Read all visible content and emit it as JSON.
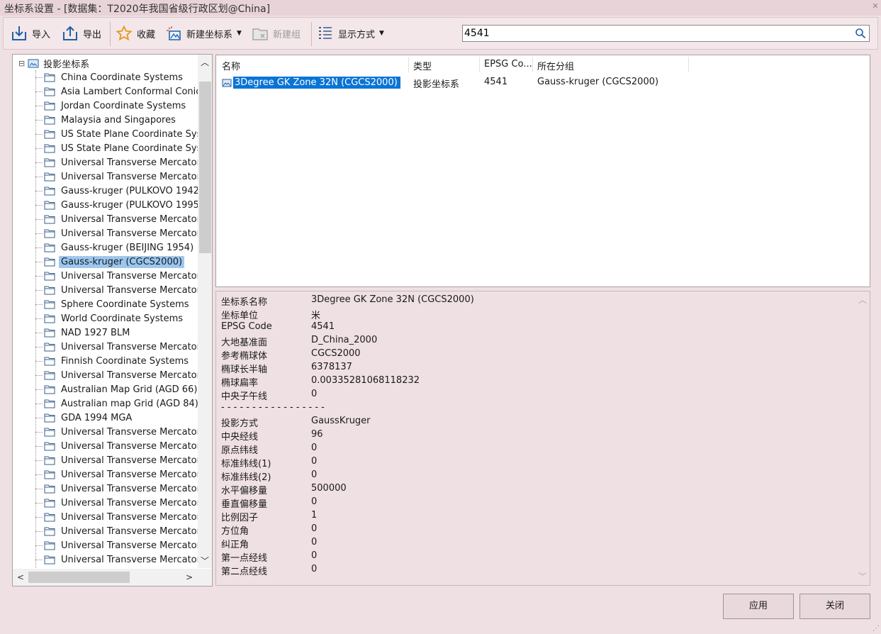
{
  "window": {
    "title": "坐标系设置 - [数据集：T2020年我国省级行政区划@China]"
  },
  "toolbar": {
    "import_label": "导入",
    "export_label": "导出",
    "favorite_label": "收藏",
    "new_coord_label": "新建坐标系",
    "new_group_label": "新建组",
    "display_label": "显示方式",
    "search_value": "4541"
  },
  "tree": {
    "root_label": "投影坐标系",
    "items": [
      "China Coordinate Systems",
      "Asia Lambert Conformal Conic",
      "Jordan Coordinate Systems",
      "Malaysia and Singapores",
      "US State Plane Coordinate Syste",
      "US State Plane Coordinate Syste",
      "Universal Transverse Mercator( \\",
      "Universal Transverse Mercator( \\",
      "Gauss-kruger (PULKOVO 1942)",
      "Gauss-kruger (PULKOVO 1995)",
      "Universal Transverse Mercator (I",
      "Universal Transverse Mercator (I",
      "Gauss-kruger (BEIJING 1954)",
      "Gauss-kruger (CGCS2000)",
      "Universal Transverse Mercator (I",
      "Universal Transverse Mercator (I",
      "Sphere Coordinate Systems",
      "World Coordinate Systems",
      "NAD 1927 BLM",
      "Universal Transverse Mercator (A",
      "Finnish Coordinate Systems",
      "Universal Transverse Mercator (S",
      "Australian Map Grid (AGD 66)",
      "Australian map Grid (AGD 84)",
      "GDA 1994 MGA",
      "Universal Transverse Mercator (A",
      "Universal Transverse Mercator (A",
      "Universal Transverse Mercator (A",
      "Universal Transverse Mercator(A",
      "Universal Transverse Mercator(E",
      "Universal Transverse Mercator(C",
      "Universal Transverse Mercator(D",
      "Universal Transverse Mercator(D",
      "Universal Transverse Mercator(F",
      "Universal Transverse Mercator(C"
    ],
    "selected_index": 13
  },
  "list": {
    "headers": [
      "名称",
      "类型",
      "EPSG Co...",
      "所在分组"
    ],
    "rows": [
      {
        "name": "3Degree GK Zone 32N    (CGCS2000)",
        "type": "投影坐标系",
        "epsg": "4541",
        "group": "Gauss-kruger (CGCS2000)"
      }
    ]
  },
  "props": {
    "items": [
      {
        "key": "坐标系名称",
        "value": "3Degree GK Zone 32N    (CGCS2000)"
      },
      {
        "key": "坐标单位",
        "value": "米"
      },
      {
        "key": "EPSG Code",
        "value": "4541"
      },
      {
        "key": "大地基准面",
        "value": "D_China_2000"
      },
      {
        "key": "参考椭球体",
        "value": "CGCS2000"
      },
      {
        "key": "椭球长半轴",
        "value": "6378137"
      },
      {
        "key": "椭球扁率",
        "value": "0.00335281068118232"
      },
      {
        "key": "中央子午线",
        "value": "0"
      }
    ],
    "separator": "- - - - - - - - - - - - - - - - -",
    "items2": [
      {
        "key": "投影方式",
        "value": "GaussKruger"
      },
      {
        "key": "中央经线",
        "value": "96"
      },
      {
        "key": "原点纬线",
        "value": "0"
      },
      {
        "key": "标准纬线(1)",
        "value": "0"
      },
      {
        "key": "标准纬线(2)",
        "value": "0"
      },
      {
        "key": "水平偏移量",
        "value": "500000"
      },
      {
        "key": "垂直偏移量",
        "value": "0"
      },
      {
        "key": "比例因子",
        "value": "1"
      },
      {
        "key": "方位角",
        "value": "0"
      },
      {
        "key": "纠正角",
        "value": "0"
      },
      {
        "key": "第一点经线",
        "value": "0"
      },
      {
        "key": "第二点经线",
        "value": "0"
      }
    ]
  },
  "buttons": {
    "apply": "应用",
    "close": "关闭"
  }
}
